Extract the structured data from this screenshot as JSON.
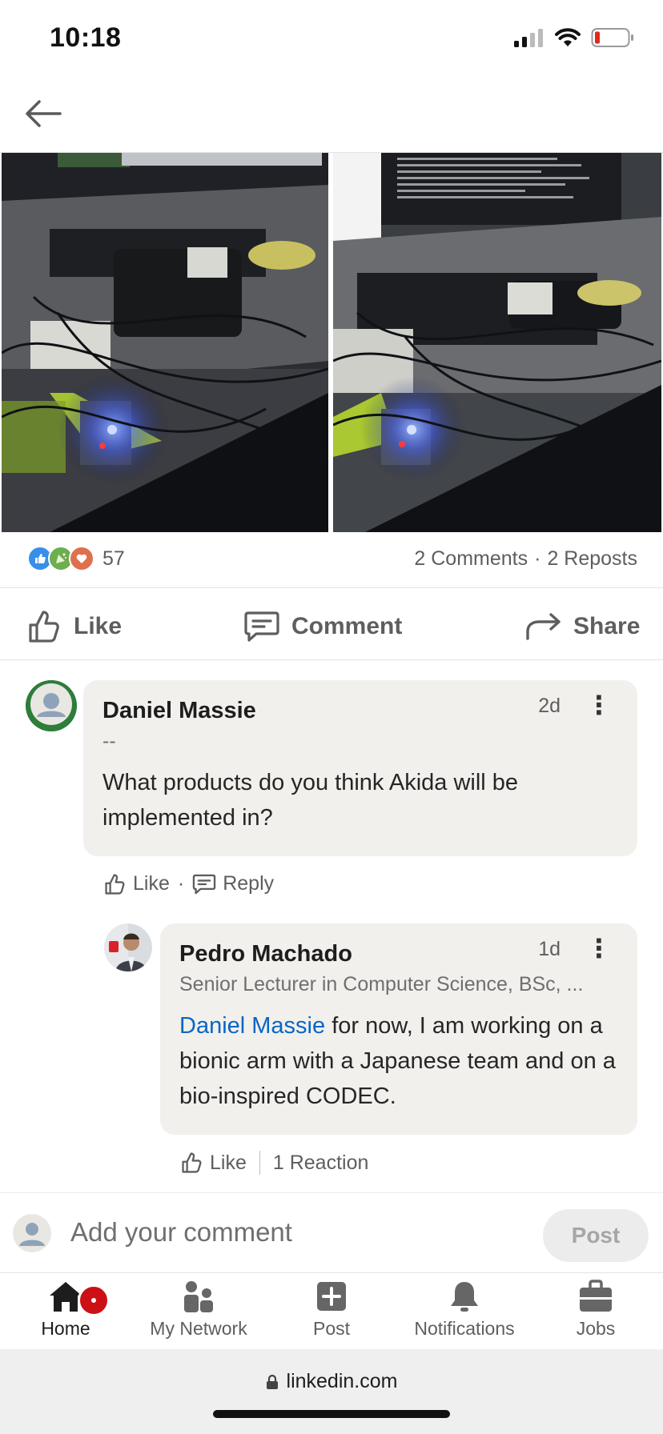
{
  "status_bar": {
    "time": "10:18"
  },
  "reactions": {
    "count": "57",
    "comments": "2 Comments",
    "separator": "·",
    "reposts": "2 Reposts"
  },
  "actions": {
    "like": "Like",
    "comment": "Comment",
    "share": "Share"
  },
  "comment1": {
    "author": "Daniel Massie",
    "headline": "--",
    "time": "2d",
    "text": "What products do you think Akida will be implemented in?",
    "like": "Like",
    "dot": "·",
    "reply": "Reply"
  },
  "comment2": {
    "author": "Pedro Machado",
    "headline": "Senior Lecturer in Computer Science, BSc, ...",
    "time": "1d",
    "mention": "Daniel Massie",
    "text": " for now, I am working on a bionic arm with a Japanese team and on a bio-inspired CODEC.",
    "like": "Like",
    "reactions": "1 Reaction"
  },
  "composer": {
    "placeholder": "Add your comment",
    "post": "Post"
  },
  "bottom_nav": {
    "home": "Home",
    "network": "My Network",
    "post": "Post",
    "notifications": "Notifications",
    "jobs": "Jobs"
  },
  "browser": {
    "url": "linkedin.com"
  },
  "colors": {
    "link": "#0a66c2",
    "badge": "#cc1016",
    "bubble": "#f2f0ed"
  }
}
